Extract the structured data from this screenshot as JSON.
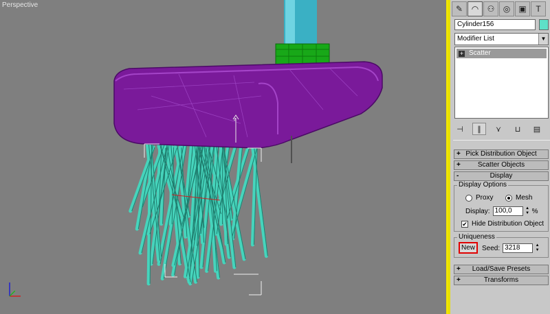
{
  "viewport": {
    "label": "Perspective"
  },
  "panel": {
    "tabs": [
      {
        "icon": "create-icon",
        "glyph": "✎"
      },
      {
        "icon": "modify-icon",
        "glyph": "◠"
      },
      {
        "icon": "hierarchy-icon",
        "glyph": "⚇"
      },
      {
        "icon": "motion-icon",
        "glyph": "◎"
      },
      {
        "icon": "display-icon",
        "glyph": "▣"
      },
      {
        "icon": "utilities-icon",
        "glyph": "T"
      }
    ],
    "object_name": "Cylinder156",
    "object_color": "#5ee0c8",
    "modifier_list": "Modifier List",
    "stack_item": "Scatter",
    "rollouts": {
      "pick_distribution": {
        "sign": "+",
        "label": "Pick Distribution Object"
      },
      "scatter_objects": {
        "sign": "+",
        "label": "Scatter Objects"
      },
      "display": {
        "sign": "-",
        "label": "Display"
      },
      "load_save": {
        "sign": "+",
        "label": "Load/Save Presets"
      },
      "transforms": {
        "sign": "+",
        "label": "Transforms"
      }
    },
    "display_options": {
      "title": "Display Options",
      "proxy": "Proxy",
      "mesh": "Mesh",
      "selected": "Mesh",
      "display_label": "Display:",
      "display_value": "100,0",
      "percent": "%",
      "hide_label": "Hide Distribution Object",
      "hide_checked": true
    },
    "uniqueness": {
      "title": "Uniqueness",
      "new_button": "New",
      "seed_label": "Seed:",
      "seed_value": "3218"
    }
  }
}
